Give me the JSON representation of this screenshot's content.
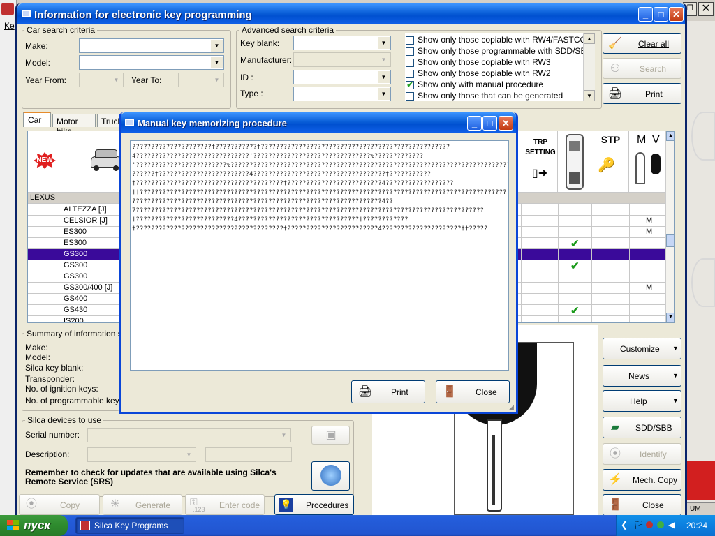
{
  "main_window": {
    "title": "Information for electronic key programming"
  },
  "bg_app": {
    "um_text": "UM",
    "left_menu_letter": "Ke"
  },
  "car_search": {
    "legend": "Car search criteria",
    "make_label": "Make:",
    "model_label": "Model:",
    "year_from_label": "Year From:",
    "year_to_label": "Year To:"
  },
  "advanced_search": {
    "legend": "Advanced search criteria",
    "key_blank_label": "Key blank:",
    "manufacturer_label": "Manufacturer:",
    "id_label": "ID :",
    "type_label": "Type :"
  },
  "filters": [
    {
      "label": "Show only those copiable with RW4/FASTCO...",
      "checked": false
    },
    {
      "label": "Show only those programmable with SDD/SBB",
      "checked": false
    },
    {
      "label": "Show only those copiable with RW3",
      "checked": false
    },
    {
      "label": "Show only those copiable with RW2",
      "checked": false
    },
    {
      "label": "Show only with manual procedure",
      "checked": true
    },
    {
      "label": "Show only those that can be generated",
      "checked": false
    }
  ],
  "right_buttons": {
    "clear_all": "Clear all",
    "search": "Search",
    "print": "Print"
  },
  "tabs": [
    "Car",
    "Motor bike",
    "Truck"
  ],
  "grid_headers": {
    "trp_setting": "TRP\nSETTING",
    "stp": "STP",
    "m": "M",
    "v": "V",
    "new_badge": "NEW"
  },
  "group_label": "LEXUS",
  "rows": [
    {
      "model": "ALTEZZA [J]",
      "check": false,
      "m": ""
    },
    {
      "model": "CELSIOR [J]",
      "check": false,
      "m": "M"
    },
    {
      "model": "ES300",
      "check": false,
      "m": "M"
    },
    {
      "model": "ES300",
      "check": true,
      "m": ""
    },
    {
      "model": "GS300",
      "check": false,
      "m": "",
      "selected": true
    },
    {
      "model": "GS300",
      "check": true,
      "m": ""
    },
    {
      "model": "GS300",
      "check": false,
      "m": ""
    },
    {
      "model": "GS300/400 [J]",
      "check": false,
      "m": "M"
    },
    {
      "model": "GS400",
      "check": false,
      "m": ""
    },
    {
      "model": "GS430",
      "check": true,
      "m": ""
    },
    {
      "model": "IS200",
      "check": false,
      "m": ""
    }
  ],
  "check_glyph": "✔",
  "summary": {
    "legend": "Summary of information sele",
    "make": "Make:",
    "model": "Model:",
    "silca_key_blank": "Silca key blank:",
    "transponder": "Transponder:",
    "ignition_keys": "No. of ignition keys:",
    "programmable_keys": "No. of programmable keys:"
  },
  "devices": {
    "legend": "Silca devices to use",
    "serial_label": "Serial number:",
    "description_label": "Description:",
    "reminder": "Remember to check for updates that are available using Silca's Remote Service (SRS)"
  },
  "bottom_buttons": {
    "copy": "Copy",
    "generate": "Generate",
    "enter_code": "Enter code",
    "enter_code_sub": ".123",
    "procedures": "Procedures"
  },
  "side_buttons": {
    "customize": "Customize",
    "news": "News",
    "help": "Help",
    "sdd_sbb": "SDD/SBB",
    "identify": "Identify",
    "mech_copy": "Mech. Copy",
    "close": "Close"
  },
  "dialog": {
    "title": "Manual key memorizing procedure",
    "lines": [
      "?????????????????????†???????????†??????????????????????????????????????????????????",
      "4??????????????????????????????'???????????????????????????????%?????????????",
      "'????????????????????????%???????????????????????????????????????????????????????????????????????????????????",
      "??????†????????????????????????4???????????????????????????????????†???????????",
      "†???????????????????????????????????????†?????????????????????????4??????????????????",
      "††?????????????????????????????????????????????????????????????????????????????????????????????????",
      "??????????????????????????????????????????????????????????????????4??",
      "7????????????????????????????????????????????????????????????????????????????????????????????",
      "†??????????????????????????4????????????????????????????????†????????????",
      "†???????????????????????????????????????†????????????????????????4?????????????????????††?????"
    ],
    "print": "Print",
    "close": "Close"
  },
  "taskbar": {
    "start": "пуск",
    "task_item": "Silca Key Programs",
    "clock": "20:24"
  }
}
